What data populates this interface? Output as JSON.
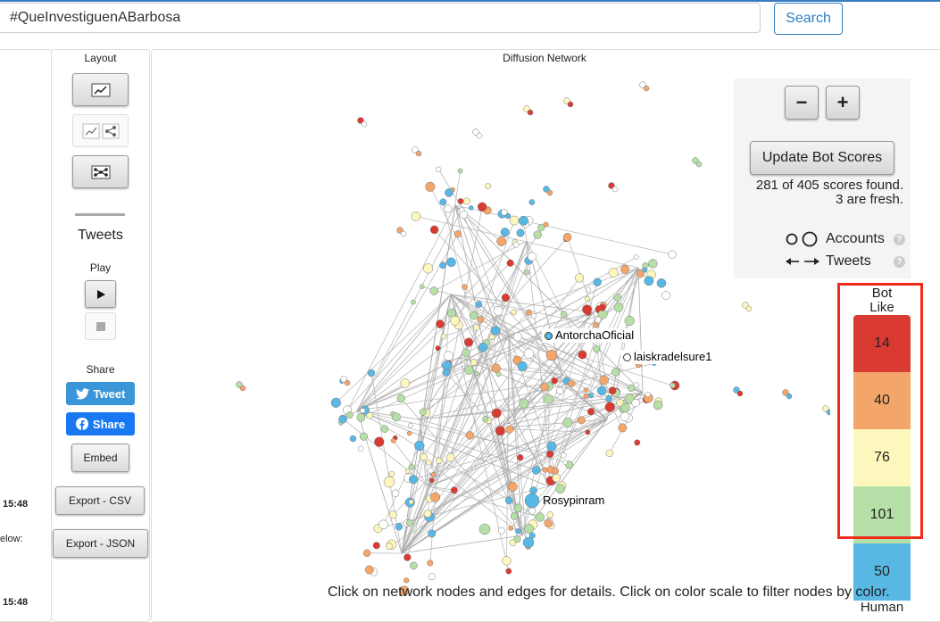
{
  "search": {
    "value": "#QueInvestiguenABarbosa",
    "button": "Search"
  },
  "left_panel": {
    "time1": "15:48",
    "below_label": "elow:",
    "time2": "15:48"
  },
  "tools": {
    "layout_label": "Layout",
    "tweets_label": "Tweets",
    "play_label": "Play",
    "share_label": "Share",
    "tweet_button": "Tweet",
    "share_button": "Share",
    "embed_button": "Embed",
    "export_csv": "Export - CSV",
    "export_json": "Export - JSON"
  },
  "network": {
    "title": "Diffusion Network",
    "labels": {
      "antorcha": "AntorchaOficial",
      "laiskra": "laiskradelsure1",
      "rosy": "Rosypinram"
    },
    "footer": "Click on network nodes and edges for details. Click on color scale to filter nodes by color."
  },
  "controls": {
    "zoom_out": "−",
    "zoom_in": "+",
    "update_button": "Update Bot Scores",
    "scores_line1": "281 of 405 scores found.",
    "scores_line2": "3 are fresh.",
    "legend_accounts": "Accounts",
    "legend_tweets": "Tweets",
    "help": "?"
  },
  "scale": {
    "top_label_1": "Bot",
    "top_label_2": "Like",
    "bottom_label": "Human",
    "cells": [
      {
        "value": "14",
        "color": "#d93b33"
      },
      {
        "value": "40",
        "color": "#f4a66a"
      },
      {
        "value": "76",
        "color": "#fdf7be"
      },
      {
        "value": "101",
        "color": "#b5dfa6"
      },
      {
        "value": "50",
        "color": "#59b7e4"
      }
    ]
  },
  "colors": {
    "accent": "#2f7ec3",
    "highlight_frame": "#ef2b1c",
    "node_palette": [
      "#d93b33",
      "#f4a66a",
      "#fdf7be",
      "#b5dfa6",
      "#59b7e4",
      "#ffffff"
    ]
  }
}
